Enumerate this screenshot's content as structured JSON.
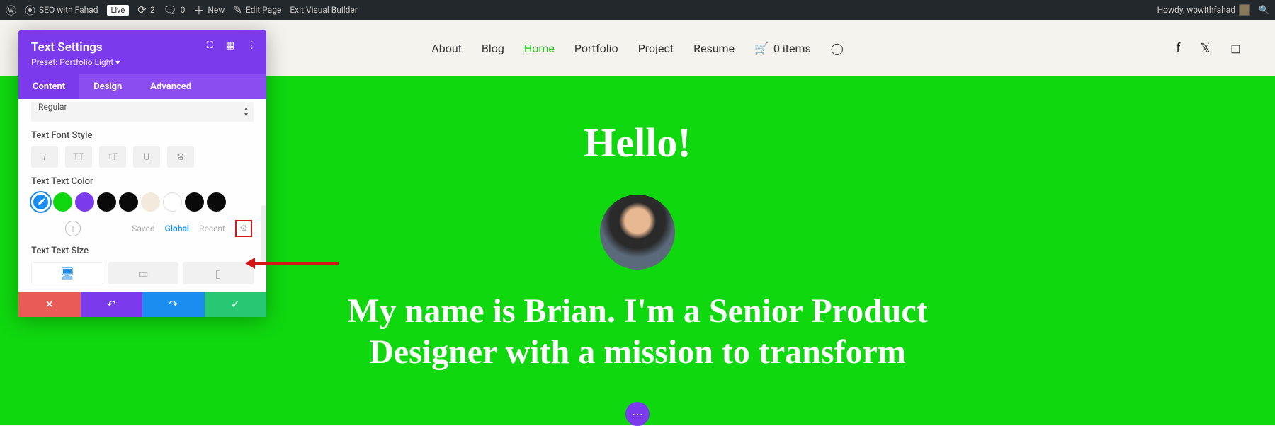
{
  "admin": {
    "site_name": "SEO with Fahad",
    "live": "Live",
    "updates": "2",
    "comments": "0",
    "new": "New",
    "edit_page": "Edit Page",
    "exit_vb": "Exit Visual Builder",
    "howdy": "Howdy, wpwithfahad"
  },
  "nav": {
    "items": [
      "About",
      "Blog",
      "Home",
      "Portfolio",
      "Project",
      "Resume"
    ],
    "active_index": 2,
    "cart": "0 items"
  },
  "hero": {
    "hello": "Hello!",
    "text1": "My name is Brian. I'm a Senior Product",
    "text2": "Designer with a mission to transform"
  },
  "panel": {
    "title": "Text Settings",
    "preset": "Preset: Portfolio Light ▾",
    "tabs": [
      "Content",
      "Design",
      "Advanced"
    ],
    "active_tab": 1,
    "font_weight_value": "Regular",
    "label_font_style": "Text Font Style",
    "label_color": "Text Text Color",
    "label_size": "Text Text Size",
    "palette_tabs": [
      "Saved",
      "Global",
      "Recent"
    ],
    "palette_active": 1,
    "swatches": [
      {
        "bg": "#0fd80f"
      },
      {
        "bg": "#7c3aed"
      },
      {
        "bg": "#0a0a0a"
      },
      {
        "bg": "#0a0a0a"
      },
      {
        "bg": "#f3e9dc"
      },
      {
        "bg": "#ffffff",
        "border": true
      },
      {
        "bg": "#0a0a0a"
      },
      {
        "bg": "#0a0a0a"
      }
    ]
  }
}
